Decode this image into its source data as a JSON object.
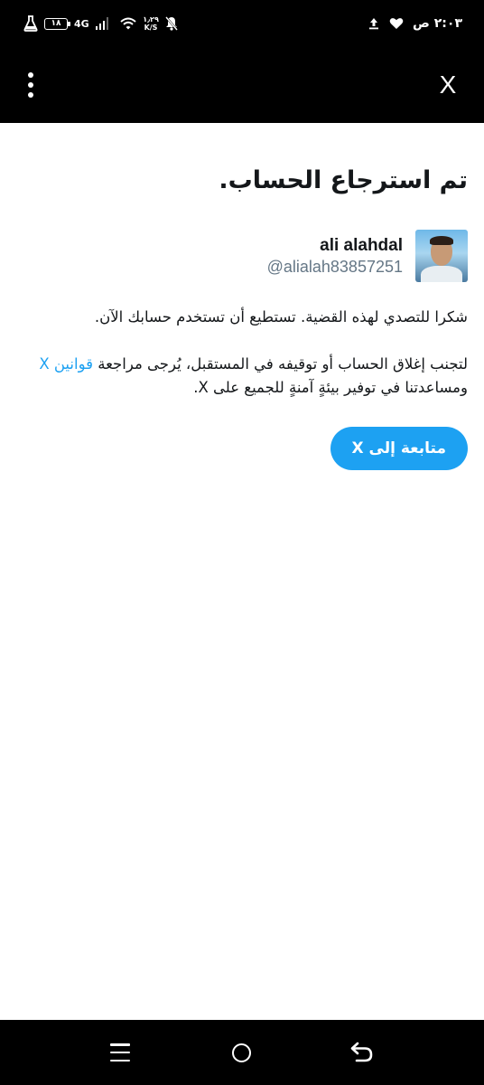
{
  "status_bar": {
    "time": "٢:٠٣ ص",
    "battery": "١٨",
    "network": "4G",
    "speed_value": "١٫٢٩",
    "speed_unit": "K/S",
    "icons": [
      "upload-icon",
      "heart-icon",
      "mute-icon",
      "wifi-icon",
      "signal-icon",
      "battery-icon",
      "flask-icon"
    ]
  },
  "header": {
    "close_label": "X"
  },
  "main": {
    "title": "تم استرجاع الحساب.",
    "user": {
      "display_name": "ali alahdal",
      "handle": "@alialah83857251"
    },
    "message_1": "شكرا للتصدي لهذه القضية. تستطيع أن تستخدم حسابك الآن.",
    "message_2_before": "لتجنب إغلاق الحساب أو توقيفه في المستقبل، يُرجى مراجعة ",
    "rules_link": "قوانين X",
    "message_2_after": " ومساعدتنا في توفير بيئةٍ آمنةٍ للجميع على X.",
    "continue_button": "متابعة إلى X"
  },
  "colors": {
    "accent": "#1da1f2",
    "text": "#14171a",
    "secondary_text": "#657786",
    "bars": "#000000"
  }
}
